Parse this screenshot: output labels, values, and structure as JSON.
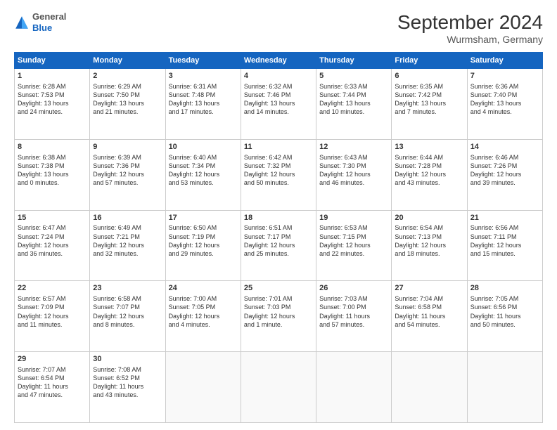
{
  "logo": {
    "general": "General",
    "blue": "Blue"
  },
  "header": {
    "month": "September 2024",
    "location": "Wurmsham, Germany"
  },
  "days_of_week": [
    "Sunday",
    "Monday",
    "Tuesday",
    "Wednesday",
    "Thursday",
    "Friday",
    "Saturday"
  ],
  "weeks": [
    [
      {
        "day": 1,
        "lines": [
          "Sunrise: 6:28 AM",
          "Sunset: 7:53 PM",
          "Daylight: 13 hours",
          "and 24 minutes."
        ]
      },
      {
        "day": 2,
        "lines": [
          "Sunrise: 6:29 AM",
          "Sunset: 7:50 PM",
          "Daylight: 13 hours",
          "and 21 minutes."
        ]
      },
      {
        "day": 3,
        "lines": [
          "Sunrise: 6:31 AM",
          "Sunset: 7:48 PM",
          "Daylight: 13 hours",
          "and 17 minutes."
        ]
      },
      {
        "day": 4,
        "lines": [
          "Sunrise: 6:32 AM",
          "Sunset: 7:46 PM",
          "Daylight: 13 hours",
          "and 14 minutes."
        ]
      },
      {
        "day": 5,
        "lines": [
          "Sunrise: 6:33 AM",
          "Sunset: 7:44 PM",
          "Daylight: 13 hours",
          "and 10 minutes."
        ]
      },
      {
        "day": 6,
        "lines": [
          "Sunrise: 6:35 AM",
          "Sunset: 7:42 PM",
          "Daylight: 13 hours",
          "and 7 minutes."
        ]
      },
      {
        "day": 7,
        "lines": [
          "Sunrise: 6:36 AM",
          "Sunset: 7:40 PM",
          "Daylight: 13 hours",
          "and 4 minutes."
        ]
      }
    ],
    [
      {
        "day": 8,
        "lines": [
          "Sunrise: 6:38 AM",
          "Sunset: 7:38 PM",
          "Daylight: 13 hours",
          "and 0 minutes."
        ]
      },
      {
        "day": 9,
        "lines": [
          "Sunrise: 6:39 AM",
          "Sunset: 7:36 PM",
          "Daylight: 12 hours",
          "and 57 minutes."
        ]
      },
      {
        "day": 10,
        "lines": [
          "Sunrise: 6:40 AM",
          "Sunset: 7:34 PM",
          "Daylight: 12 hours",
          "and 53 minutes."
        ]
      },
      {
        "day": 11,
        "lines": [
          "Sunrise: 6:42 AM",
          "Sunset: 7:32 PM",
          "Daylight: 12 hours",
          "and 50 minutes."
        ]
      },
      {
        "day": 12,
        "lines": [
          "Sunrise: 6:43 AM",
          "Sunset: 7:30 PM",
          "Daylight: 12 hours",
          "and 46 minutes."
        ]
      },
      {
        "day": 13,
        "lines": [
          "Sunrise: 6:44 AM",
          "Sunset: 7:28 PM",
          "Daylight: 12 hours",
          "and 43 minutes."
        ]
      },
      {
        "day": 14,
        "lines": [
          "Sunrise: 6:46 AM",
          "Sunset: 7:26 PM",
          "Daylight: 12 hours",
          "and 39 minutes."
        ]
      }
    ],
    [
      {
        "day": 15,
        "lines": [
          "Sunrise: 6:47 AM",
          "Sunset: 7:24 PM",
          "Daylight: 12 hours",
          "and 36 minutes."
        ]
      },
      {
        "day": 16,
        "lines": [
          "Sunrise: 6:49 AM",
          "Sunset: 7:21 PM",
          "Daylight: 12 hours",
          "and 32 minutes."
        ]
      },
      {
        "day": 17,
        "lines": [
          "Sunrise: 6:50 AM",
          "Sunset: 7:19 PM",
          "Daylight: 12 hours",
          "and 29 minutes."
        ]
      },
      {
        "day": 18,
        "lines": [
          "Sunrise: 6:51 AM",
          "Sunset: 7:17 PM",
          "Daylight: 12 hours",
          "and 25 minutes."
        ]
      },
      {
        "day": 19,
        "lines": [
          "Sunrise: 6:53 AM",
          "Sunset: 7:15 PM",
          "Daylight: 12 hours",
          "and 22 minutes."
        ]
      },
      {
        "day": 20,
        "lines": [
          "Sunrise: 6:54 AM",
          "Sunset: 7:13 PM",
          "Daylight: 12 hours",
          "and 18 minutes."
        ]
      },
      {
        "day": 21,
        "lines": [
          "Sunrise: 6:56 AM",
          "Sunset: 7:11 PM",
          "Daylight: 12 hours",
          "and 15 minutes."
        ]
      }
    ],
    [
      {
        "day": 22,
        "lines": [
          "Sunrise: 6:57 AM",
          "Sunset: 7:09 PM",
          "Daylight: 12 hours",
          "and 11 minutes."
        ]
      },
      {
        "day": 23,
        "lines": [
          "Sunrise: 6:58 AM",
          "Sunset: 7:07 PM",
          "Daylight: 12 hours",
          "and 8 minutes."
        ]
      },
      {
        "day": 24,
        "lines": [
          "Sunrise: 7:00 AM",
          "Sunset: 7:05 PM",
          "Daylight: 12 hours",
          "and 4 minutes."
        ]
      },
      {
        "day": 25,
        "lines": [
          "Sunrise: 7:01 AM",
          "Sunset: 7:03 PM",
          "Daylight: 12 hours",
          "and 1 minute."
        ]
      },
      {
        "day": 26,
        "lines": [
          "Sunrise: 7:03 AM",
          "Sunset: 7:00 PM",
          "Daylight: 11 hours",
          "and 57 minutes."
        ]
      },
      {
        "day": 27,
        "lines": [
          "Sunrise: 7:04 AM",
          "Sunset: 6:58 PM",
          "Daylight: 11 hours",
          "and 54 minutes."
        ]
      },
      {
        "day": 28,
        "lines": [
          "Sunrise: 7:05 AM",
          "Sunset: 6:56 PM",
          "Daylight: 11 hours",
          "and 50 minutes."
        ]
      }
    ],
    [
      {
        "day": 29,
        "lines": [
          "Sunrise: 7:07 AM",
          "Sunset: 6:54 PM",
          "Daylight: 11 hours",
          "and 47 minutes."
        ]
      },
      {
        "day": 30,
        "lines": [
          "Sunrise: 7:08 AM",
          "Sunset: 6:52 PM",
          "Daylight: 11 hours",
          "and 43 minutes."
        ]
      },
      null,
      null,
      null,
      null,
      null
    ]
  ]
}
